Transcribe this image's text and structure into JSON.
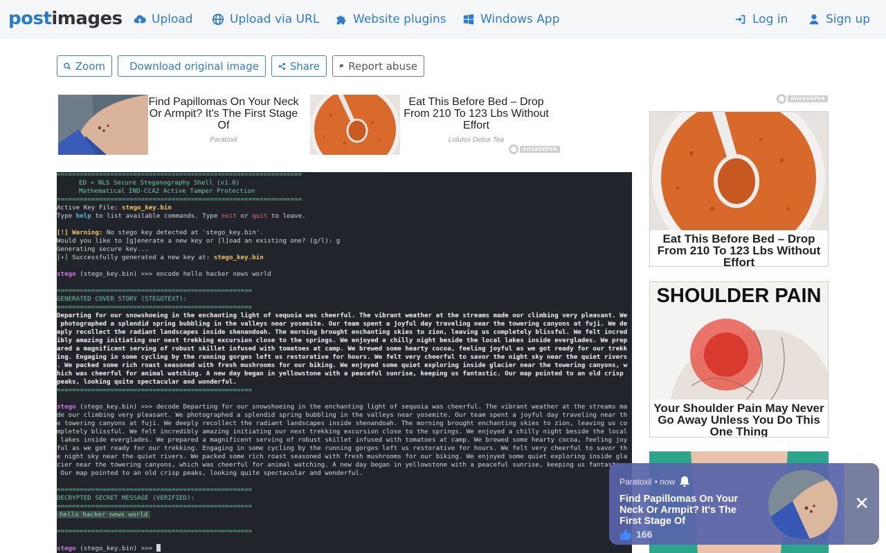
{
  "header": {
    "logo_part1": "post",
    "logo_part2": "images",
    "nav": {
      "upload": "Upload",
      "upload_url": "Upload via URL",
      "plugins": "Website plugins",
      "windows_app": "Windows App",
      "login": "Log in",
      "signup": "Sign up"
    }
  },
  "toolbar": {
    "zoom": "Zoom",
    "download": "Download original image",
    "share": "Share",
    "report": "Report abuse"
  },
  "top_ads": [
    {
      "title": "Find Papillomas On Your Neck Or Armpit? It's The First Stage Of",
      "source": "Paratoxil"
    },
    {
      "title": "Eat This Before Bed – Drop From 210 To 123 Lbs Without Effort",
      "source": "Lulutox Detox Tea"
    }
  ],
  "adkeeper_label": "ADSKEEPER",
  "terminal": {
    "rule": "================================================================",
    "rule_short": "===================================================",
    "banner_1": "ED + NLS Secure Steganography Shell (v1.0)",
    "banner_2": "Mathematical IND-CCA2 Active Tamper Protection",
    "active_key_label": "Active Key File: ",
    "active_key": "stego_key.bin",
    "help_pre": "Type ",
    "help_word": "help",
    "help_mid": " to list available commands. Type ",
    "exit_word": "exit",
    "or_word": " or ",
    "quit_word": "quit",
    "leave": " to leave.",
    "warn_tag": "[!] Warning:",
    "warn_text": " No stego key detected at 'stego_key.bin'.",
    "prompt_gen": "Would you like to [g]enerate a new key or [l]oad an existing one? (g/l): g",
    "generating": "Generating secure key...",
    "success_tag": "[+]",
    "success_text": " Successfully generated a new key at: ",
    "success_file": "stego_key.bin",
    "prompt_name": "stego",
    "prompt_key": " (stego_key.bin) >>> ",
    "cmd_encode": "encode hello hacker news world",
    "cover_header": "GENERATED COVER STORY (STEGOTEXT):",
    "cover_lines": [
      "Departing for our snowshoeing in the enchanting light of sequoia was cheerful. The vibrant weather at the streams made our climbing very pleasant. We",
      " photographed a splendid spring bubbling in the valleys near yosemite. Our team spent a joyful day traveling near the towering canyons at fuji. We de",
      "eply recollect the radiant landscapes inside shenandoah. The morning brought enchanting skies to zion, leaving us completely blissful. We felt incred",
      "ibly amazing initiating our next trekking excursion close to the springs. We enjoyed a chilly night beside the local lakes inside everglades. We prep",
      "ared a magnificent serving of robust skillet infused with tomatoes at camp. We brewed some hearty cocoa, feeling joyful as we got ready for our trekk",
      "ing. Engaging in some cycling by the running gorges left us restorative for hours. We felt very cheerful to savor the night sky near the quiet rivers",
      ". We packed some rich roast seasoned with fresh mushrooms for our biking. We enjoyed some quiet exploring inside glacier near the towering canyons, w",
      "hich was cheerful for animal watching. A new day began in yellowstone with a peaceful sunrise, keeping us fantastic. Our map pointed to an old crisp",
      "peaks, looking quite spectacular and wonderful."
    ],
    "decode_lines": [
      "decode Departing for our snowshoeing in the enchanting light of sequoia was cheerful. The vibrant weather at the streams ma",
      "de our climbing very pleasant. We photographed a splendid spring bubbling in the valleys near yosemite. Our team spent a joyful day traveling near th",
      "e towering canyons at fuji. We deeply recollect the radiant landscapes inside shenandoah. The morning brought enchanting skies to zion, leaving us co",
      "mpletely blissful. We felt incredibly amazing initiating our next trekking excursion close to the springs. We enjoyed a chilly night beside the local",
      " lakes inside everglades. We prepared a magnificent serving of robust skillet infused with tomatoes at camp. We brewed some hearty cocoa, feeling joy",
      "ful as we got ready for our trekking. Engaging in some cycling by the running gorges left us restorative for hours. We felt very cheerful to savor th",
      "e night sky near the quiet rivers. We packed some rich roast seasoned with fresh mushrooms for our biking. We enjoyed some quiet exploring inside gla",
      "cier near the towering canyons, which was cheerful for animal watching. A new day began in yellowstone with a peaceful sunrise, keeping us fantastic.",
      " Our map pointed to an old crisp peaks, looking quite spectacular and wonderful."
    ],
    "decrypted_header": "DECRYPTED SECRET MESSAGE (VERIFIED):",
    "secret": "hello hacker news world"
  },
  "right_ads": [
    {
      "caption": "Eat This Before Bed – Drop From 210 To 123 Lbs Without Effort"
    },
    {
      "headline": "SHOULDER PAIN",
      "caption": "Your Shoulder Pain May Never Go Away Unless You Do This One Thing"
    }
  ],
  "notification": {
    "source": "Paratoxil",
    "time": "• now",
    "title": "Find Papillomas On Your Neck Or Armpit? It's The First Stage Of",
    "likes": "166",
    "close": "✕"
  },
  "colors": {
    "brand_blue": "#2e7bc9",
    "terminal_bg": "#21252b",
    "teal": "#6ec6ab",
    "warning_yellow": "#f0c75e"
  }
}
